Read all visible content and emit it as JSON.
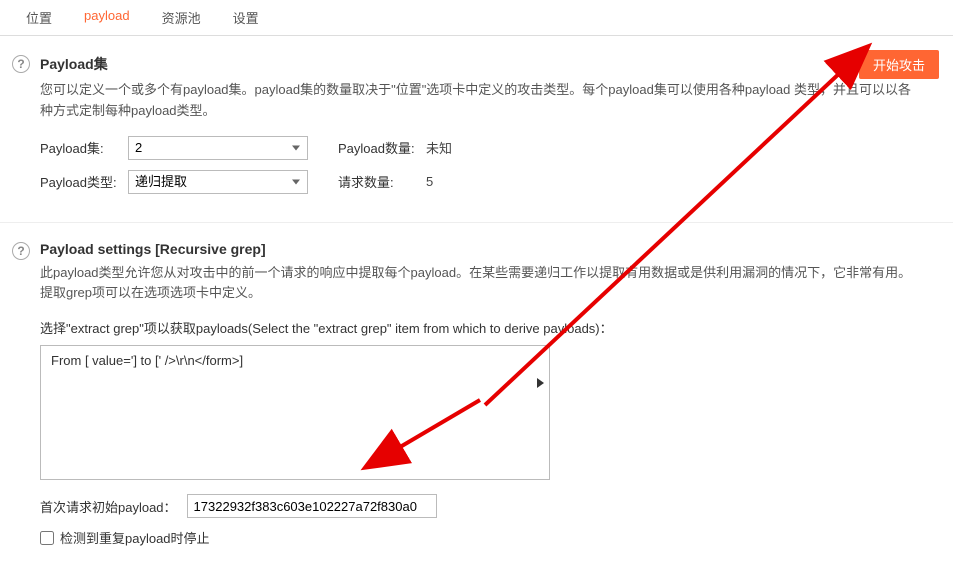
{
  "tabs": {
    "t0": "位置",
    "t1": "payload",
    "t2": "资源池",
    "t3": "设置"
  },
  "sec1": {
    "title": "Payload集",
    "desc": "您可以定义一个或多个有payload集。payload集的数量取决于\"位置\"选项卡中定义的攻击类型。每个payload集可以使用各种payload 类型，并且可以以各种方式定制每种payload类型。",
    "attack_btn": "开始攻击",
    "row1": {
      "label": "Payload集:",
      "value": "2",
      "count_label": "Payload数量:",
      "count_value": "未知"
    },
    "row2": {
      "label": "Payload类型:",
      "value": "递归提取",
      "req_label": "请求数量:",
      "req_value": "5"
    }
  },
  "sec2": {
    "title": "Payload settings [Recursive grep]",
    "desc": "此payload类型允许您从对攻击中的前一个请求的响应中提取每个payload。在某些需要递归工作以提取有用数据或是供利用漏洞的情况下，它非常有用。提取grep项可以在选项选项卡中定义。",
    "extract_label": "选择\"extract grep\"项以获取payloads(Select the \"extract grep\" item from which to derive payloads)：",
    "list_item1": "From [ value='] to [' />\\r\\n</form>]",
    "initial_label": "首次请求初始payload：",
    "initial_value": "17322932f383c603e102227a72f830a0",
    "stop_label": "检测到重复payload时停止"
  }
}
